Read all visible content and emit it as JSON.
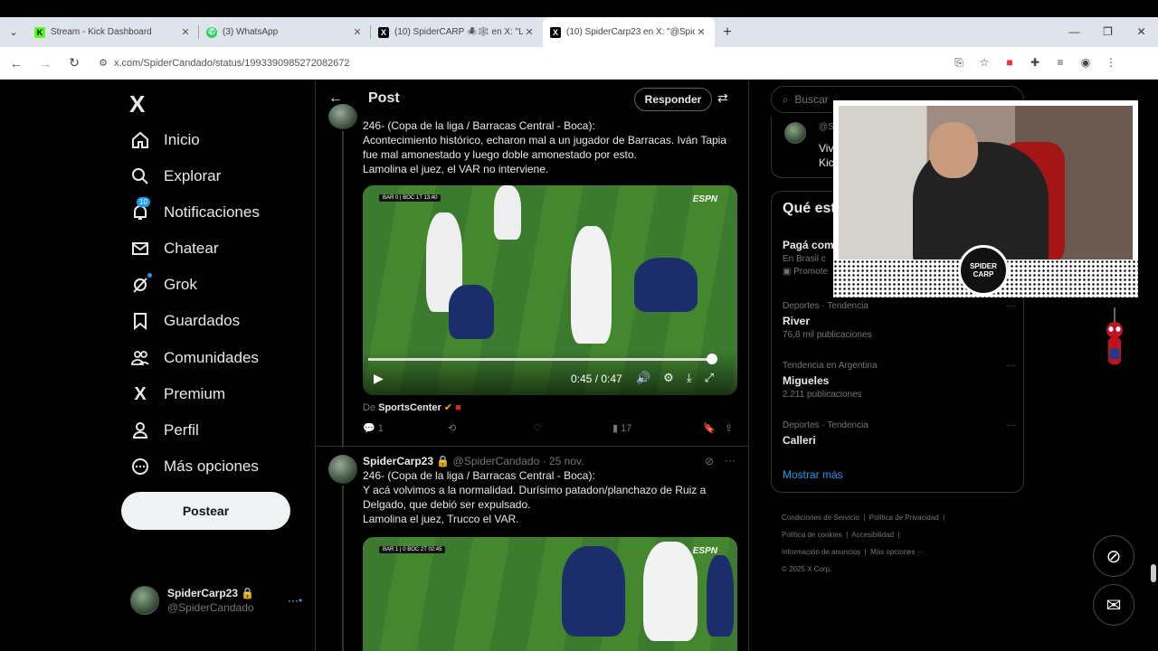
{
  "browser": {
    "tabs": [
      {
        "title": "Stream - Kick Dashboard",
        "favicon": "kick-icon",
        "color": "#53fc18"
      },
      {
        "title": "(3) WhatsApp",
        "favicon": "whatsapp-icon",
        "color": "#25d366"
      },
      {
        "title": "(10) SpiderCARP 🕷️🕸️ en X: \"L",
        "favicon": "x-icon",
        "color": "#000000"
      },
      {
        "title": "(10) SpiderCarp23 en X: \"@Spid",
        "favicon": "x-icon",
        "color": "#000000"
      }
    ],
    "url": "x.com/SpiderCandado/status/1993390985272082672"
  },
  "sidebar": {
    "logo": "X",
    "items": [
      {
        "label": "Inicio",
        "icon": "home-icon"
      },
      {
        "label": "Explorar",
        "icon": "search-icon"
      },
      {
        "label": "Notificaciones",
        "icon": "bell-icon",
        "badge": "10"
      },
      {
        "label": "Chatear",
        "icon": "mail-icon"
      },
      {
        "label": "Grok",
        "icon": "grok-icon"
      },
      {
        "label": "Guardados",
        "icon": "bookmark-icon"
      },
      {
        "label": "Comunidades",
        "icon": "people-icon"
      },
      {
        "label": "Premium",
        "icon": "x-icon"
      },
      {
        "label": "Perfil",
        "icon": "person-icon"
      },
      {
        "label": "Más opciones",
        "icon": "more-icon"
      }
    ],
    "post_button": "Postear",
    "account": {
      "name": "SpiderCarp23",
      "handle": "@SpiderCandado"
    }
  },
  "header": {
    "title": "Post",
    "reply_button": "Responder"
  },
  "tweet1": {
    "lines": [
      "246- (Copa de la liga / Barracas Central - Boca):",
      "Acontecimiento histórico, echaron mal a un jugador de Barracas. Iván Tapia",
      "fue mal amonestado y luego doble amonestado por esto.",
      "Lamolina el juez, el VAR no interviene."
    ],
    "video": {
      "scorebug": "BAR 0 | BOC 1T 13:40",
      "brand": "ESPN",
      "time": "0:45 / 0:47",
      "progress": 0.96
    },
    "source_prefix": "De",
    "source": "SportsCenter",
    "replies": "1",
    "views": "17"
  },
  "tweet2": {
    "name": "SpiderCarp23",
    "handle": "@SpiderCandado",
    "date": "· 25 nov.",
    "lines": [
      "246- (Copa de la liga / Barracas Central - Boca):",
      "Y acá volvimos a la normalidad. Durísimo patadon/planchazo de Ruiz a",
      "Delgado, que debió ser expulsado.",
      "Lamolina el juez, Trucco el VAR."
    ],
    "video": {
      "scorebug": "BAR 1 | 0 BOC 2T 02:45",
      "brand": "ESPN"
    }
  },
  "right": {
    "search_placeholder": "Buscar",
    "box1_lines": [
      "@S",
      "Viv",
      "Kic"
    ],
    "trends_title": "Qué está pasando",
    "trends": [
      {
        "context": "",
        "name": "Pagá com",
        "meta": "En Brasil c",
        "extra": "Promote"
      },
      {
        "context": "Deportes · Tendencia",
        "name": "River",
        "meta": "76,8 mil publicaciones"
      },
      {
        "context": "Tendencia en Argentina",
        "name": "Migueles",
        "meta": "2.211 publicaciones"
      },
      {
        "context": "Deportes · Tendencia",
        "name": "Calleri",
        "meta": ""
      }
    ],
    "show_more": "Mostrar más",
    "footer": [
      "Condiciones de Servicio",
      "Política de Privacidad",
      "Política de cookies",
      "Accesibilidad",
      "Información de anuncios",
      "Más opciones ···",
      "© 2025 X Corp."
    ]
  },
  "webcam": {
    "logo_text": "SPIDER CARP"
  }
}
